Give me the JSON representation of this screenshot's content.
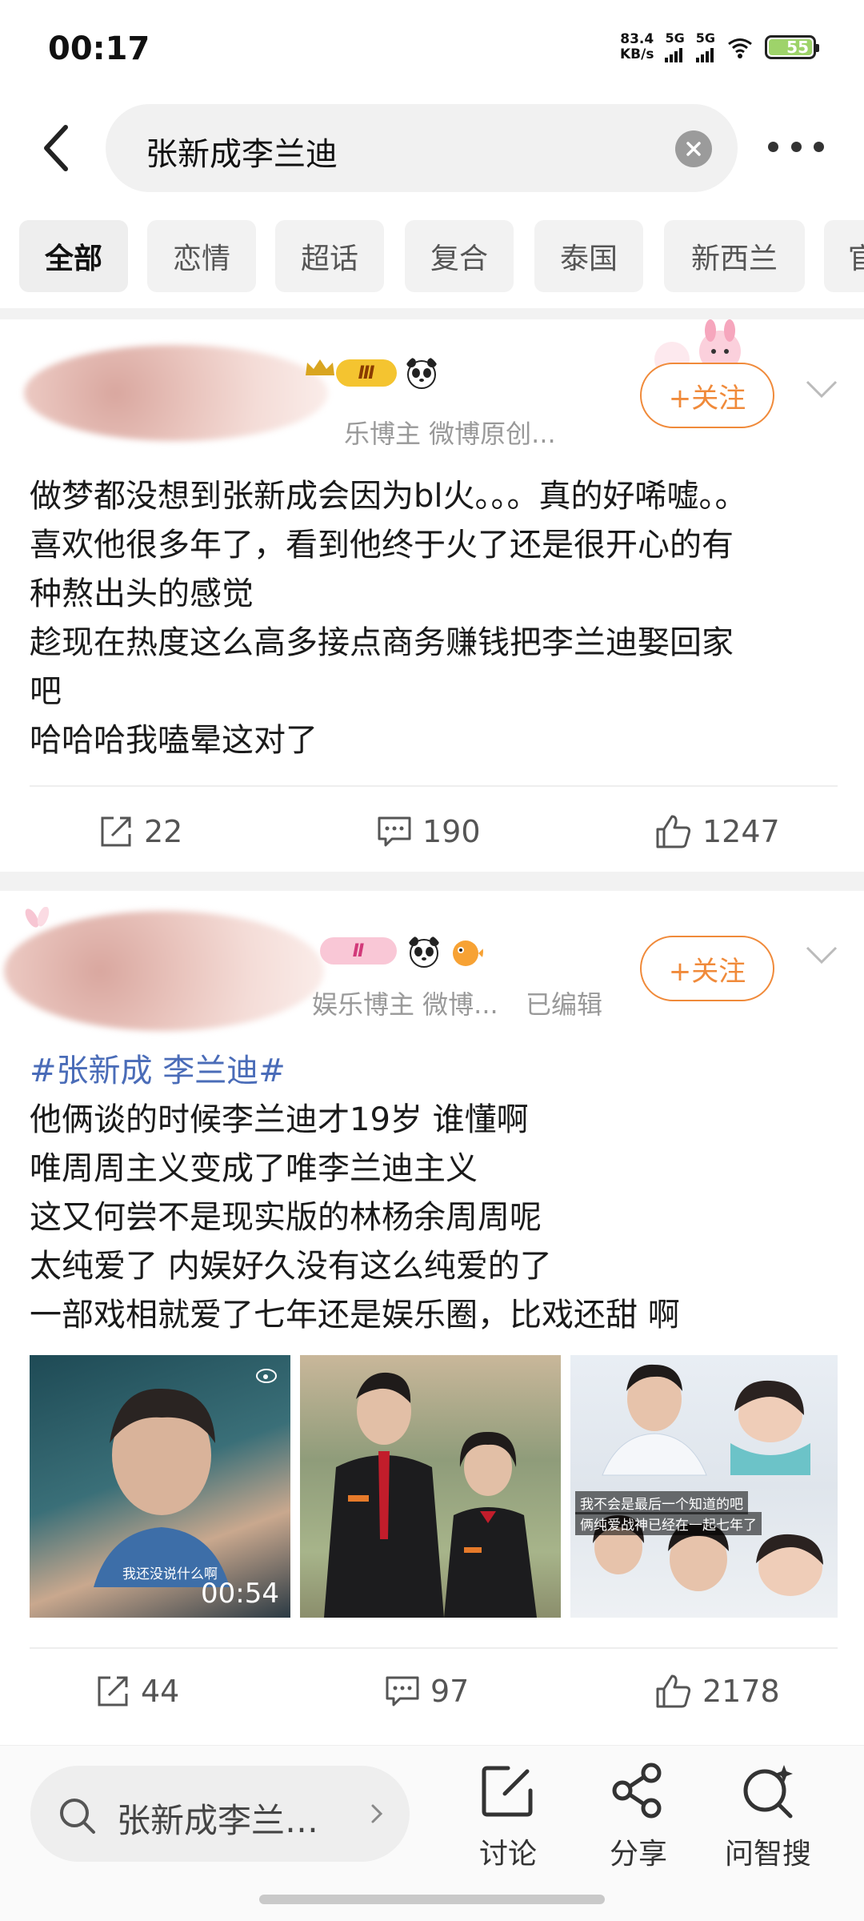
{
  "status_bar": {
    "time": "00:17",
    "net_speed_value": "83.4",
    "net_speed_unit": "KB/s",
    "sim1": "5G",
    "sim2": "5G",
    "battery": "55"
  },
  "search": {
    "query": "张新成李兰迪",
    "back_icon": "chevron-left-icon",
    "clear_icon": "clear-circle-icon",
    "more_icon": "more-dots-icon"
  },
  "tabs": [
    {
      "label": "全部",
      "active": true
    },
    {
      "label": "恋情",
      "active": false
    },
    {
      "label": "超话",
      "active": false
    },
    {
      "label": "复合",
      "active": false
    },
    {
      "label": "泰国",
      "active": false
    },
    {
      "label": "新西兰",
      "active": false
    },
    {
      "label": "官",
      "active": false
    }
  ],
  "posts": [
    {
      "badge": "Ⅲ",
      "meta": "乐博主 微博原创...",
      "follow_label": "+关注",
      "lines": [
        "做梦都没想到张新成会因为bl火。。。真的好唏嘘。。",
        "喜欢他很多年了，看到他终于火了还是很开心的有",
        "种熬出头的感觉",
        "趁现在热度这么高多接点商务赚钱把李兰迪娶回家",
        "吧",
        "哈哈哈我嗑晕这对了"
      ],
      "reposts": "22",
      "comments": "190",
      "likes": "1247"
    },
    {
      "badge": "Ⅱ",
      "meta": "娱乐博主 微博...",
      "edited": "已编辑",
      "follow_label": "+关注",
      "hashtag": "#张新成 李兰迪#",
      "lines": [
        "他俩谈的时候李兰迪才19岁 谁懂啊",
        "唯周周主义变成了唯李兰迪主义",
        "这又何尝不是现实版的林杨余周周呢",
        "太纯爱了 内娱好久没有这么纯爱的了",
        "一部戏相就爱了七年还是娱乐圈，比戏还甜 啊"
      ],
      "media": {
        "video_duration": "00:54",
        "video_caption": "我还没说什么啊",
        "image3_caption1": "我不会是最后一个知道的吧",
        "image3_caption2": "俩纯爱战神已经在一起七年了"
      },
      "reposts": "44",
      "comments": "97",
      "likes": "2178"
    }
  ],
  "bottom_bar": {
    "search_text": "张新成李兰…",
    "discuss": "讨论",
    "share": "分享",
    "ask": "问智搜"
  },
  "colors": {
    "accent_orange": "#f08a3a",
    "hashtag_blue": "#4a6cb8",
    "battery_green": "#9ed36a"
  }
}
